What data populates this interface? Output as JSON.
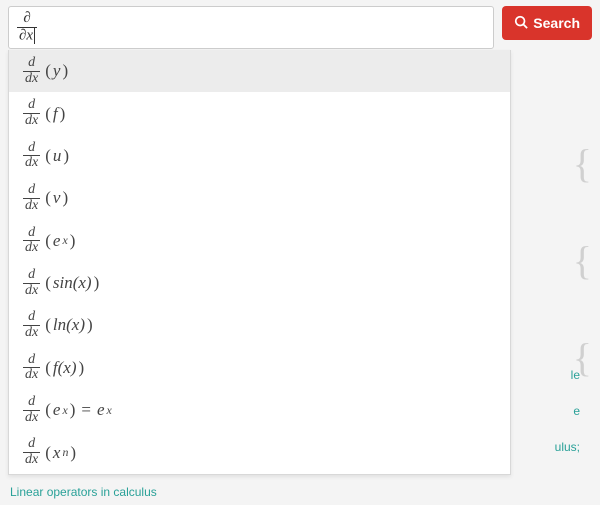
{
  "search": {
    "input_numerator": "∂",
    "input_denominator": "∂x",
    "button_label": "Search"
  },
  "suggestions": [
    {
      "frac_num": "d",
      "frac_den": "dx",
      "arg": "y"
    },
    {
      "frac_num": "d",
      "frac_den": "dx",
      "arg": "f"
    },
    {
      "frac_num": "d",
      "frac_den": "dx",
      "arg": "u"
    },
    {
      "frac_num": "d",
      "frac_den": "dx",
      "arg": "v"
    },
    {
      "frac_num": "d",
      "frac_den": "dx",
      "arg": "e",
      "arg_sup": "x"
    },
    {
      "frac_num": "d",
      "frac_den": "dx",
      "arg": "sin(x)"
    },
    {
      "frac_num": "d",
      "frac_den": "dx",
      "arg": "ln(x)"
    },
    {
      "frac_num": "d",
      "frac_den": "dx",
      "arg": "f(x)"
    },
    {
      "frac_num": "d",
      "frac_den": "dx",
      "arg": "e",
      "arg_sup": "x",
      "rhs": "e",
      "rhs_sup": "x"
    },
    {
      "frac_num": "d",
      "frac_den": "dx",
      "arg": "x",
      "arg_sup": "n"
    }
  ],
  "bg": {
    "link1": "le",
    "link2": "e",
    "link3": "ulus;"
  },
  "footer": {
    "link": "Linear operators in calculus"
  }
}
